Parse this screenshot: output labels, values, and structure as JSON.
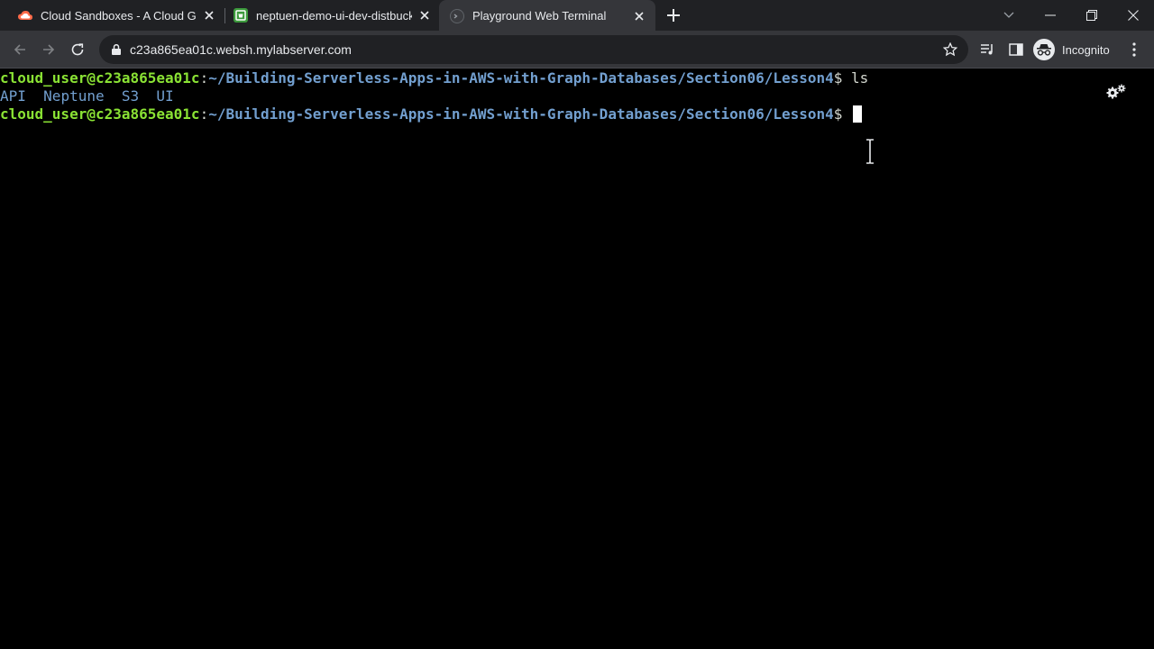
{
  "browser": {
    "tabs": [
      {
        "title": "Cloud Sandboxes - A Cloud Guru",
        "favicon": "cloud-icon"
      },
      {
        "title": "neptuen-demo-ui-dev-distbucke",
        "favicon": "bucket-icon"
      },
      {
        "title": "Playground Web Terminal",
        "favicon": "terminal-icon",
        "active": true
      }
    ],
    "address_bar": {
      "url": "c23a865ea01c.websh.mylabserver.com"
    },
    "profile_label": "Incognito"
  },
  "terminal": {
    "lines": [
      {
        "user_host": "cloud_user@c23a865ea01c",
        "sep": ":",
        "path": "~/Building-Serverless-Apps-in-AWS-with-Graph-Databases/Section06/Lesson4",
        "prompt": "$",
        "command": " ls"
      },
      {
        "entries": [
          "API",
          "Neptune",
          "S3",
          "UI"
        ]
      },
      {
        "user_host": "cloud_user@c23a865ea01c",
        "sep": ":",
        "path": "~/Building-Serverless-Apps-in-AWS-with-Graph-Databases/Section06/Lesson4",
        "prompt": "$",
        "command": " "
      }
    ]
  },
  "colors": {
    "user_host": "#8ae234",
    "path": "#729fcf",
    "background": "#000000",
    "chrome_dark": "#202124",
    "chrome_toolbar": "#35363a"
  }
}
